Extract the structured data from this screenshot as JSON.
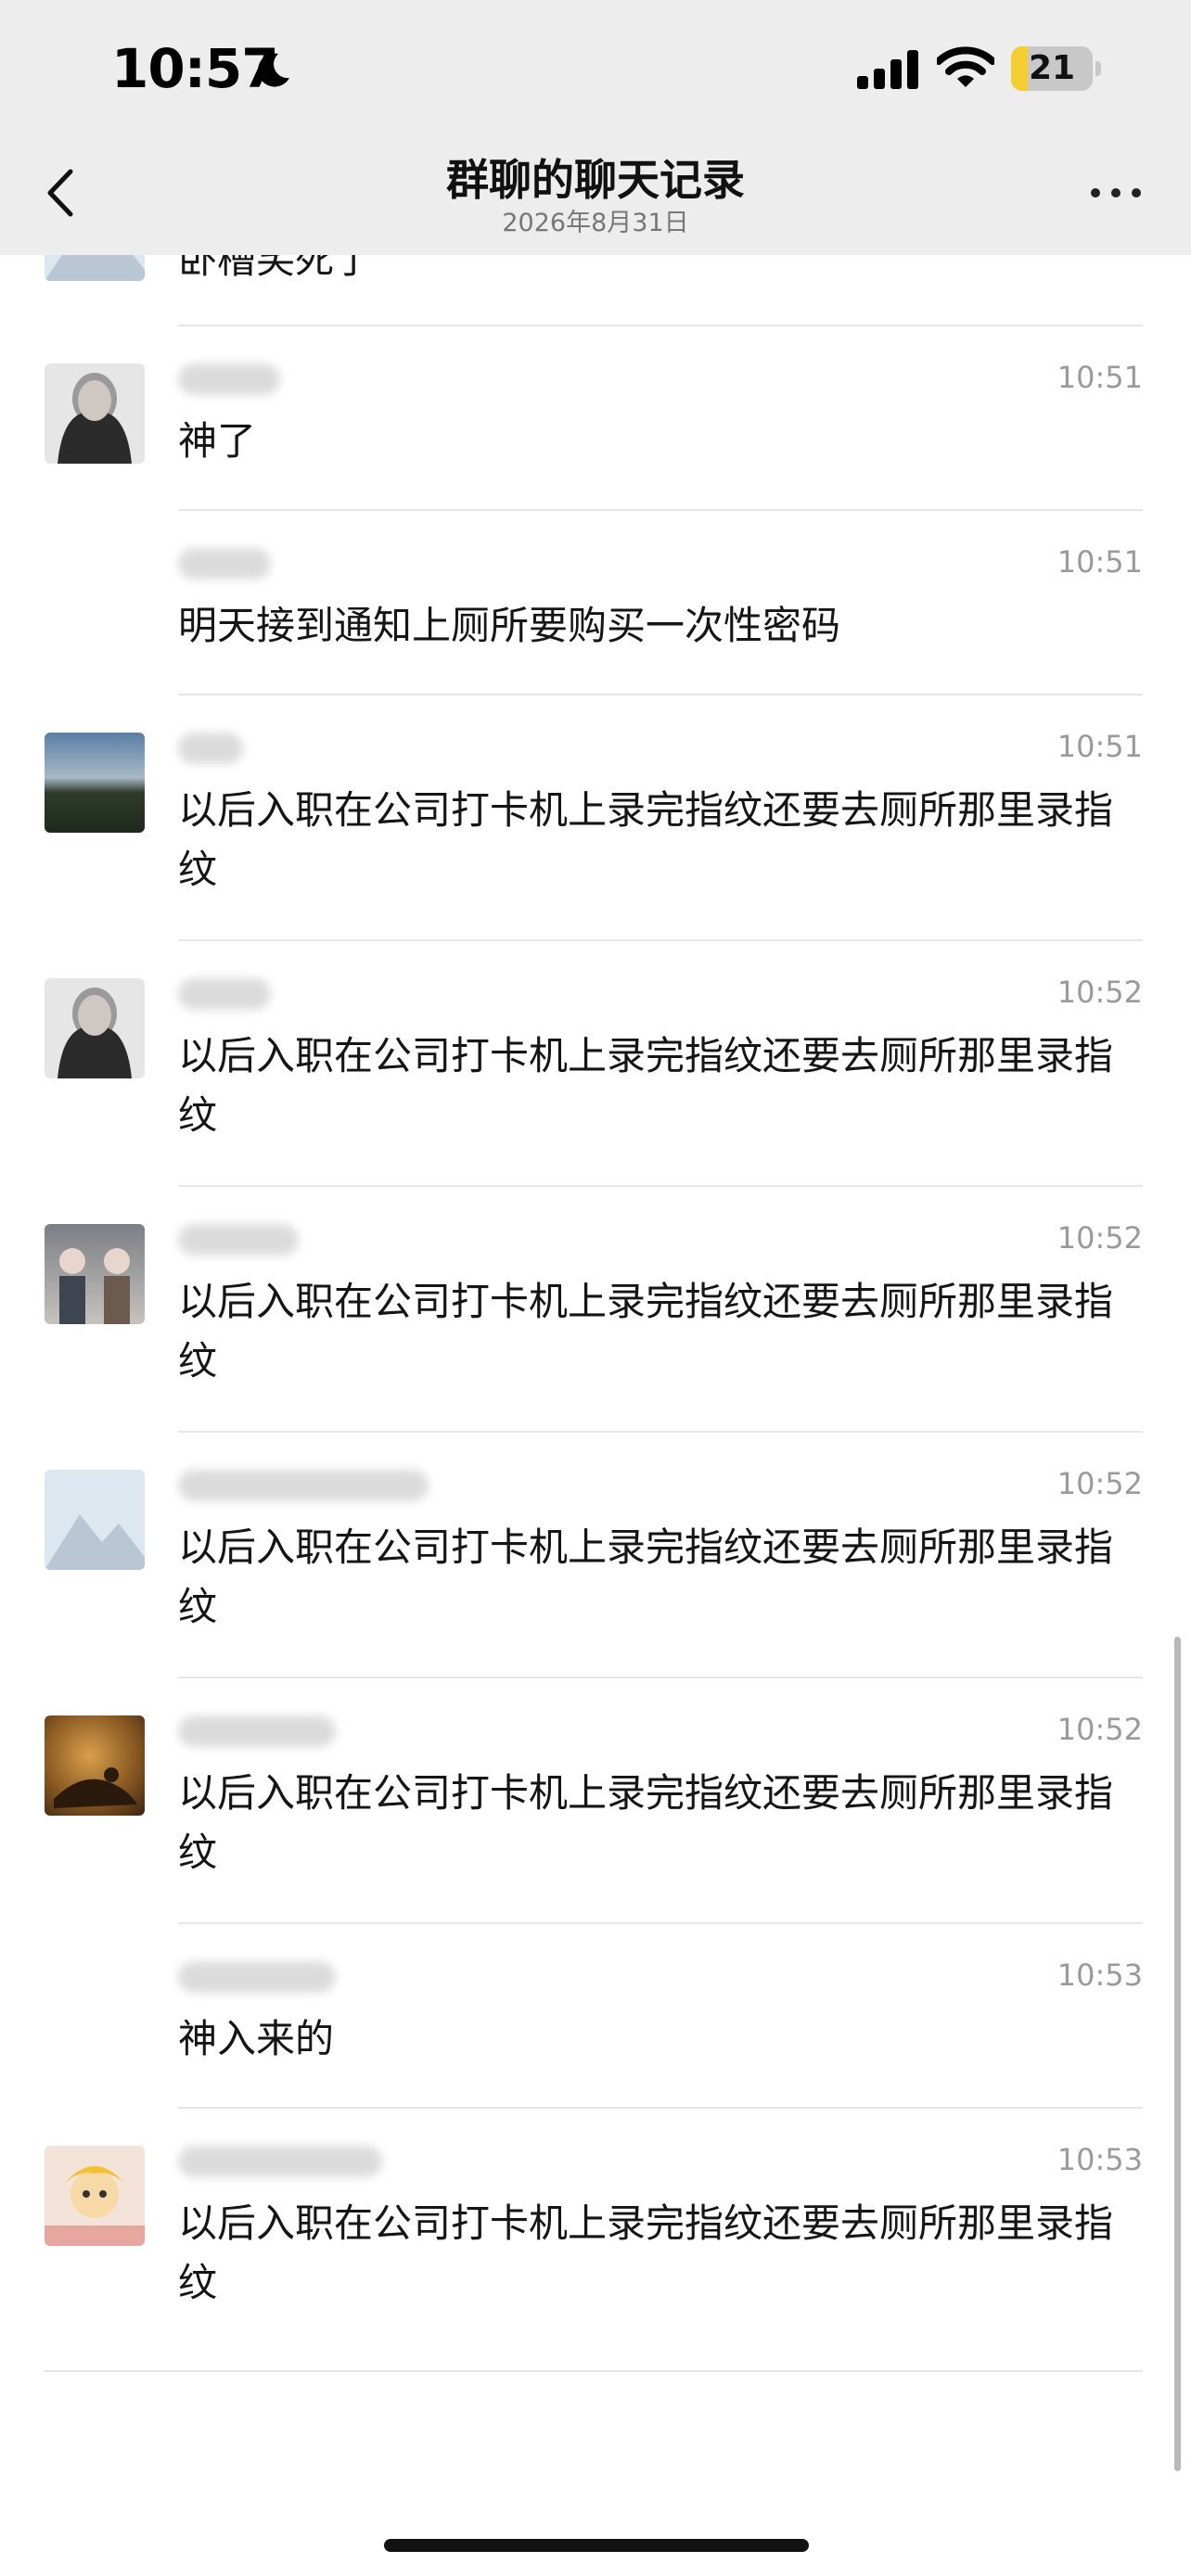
{
  "status_bar": {
    "time": "10:57",
    "battery_level": "21",
    "battery_fraction": 0.21,
    "icons": [
      "moon-icon",
      "signal-icon",
      "wifi-icon",
      "battery-icon"
    ]
  },
  "header": {
    "title": "群聊的聊天记录",
    "date": "2026年8月31日",
    "back_icon": "chevron-left-icon",
    "more_icon": "more-dots-icon"
  },
  "partial_message": {
    "text": "卧槽笑死了"
  },
  "messages": [
    {
      "time": "10:51",
      "text": "神了",
      "avatar": "girl"
    },
    {
      "time": "10:51",
      "text": "明天接到通知上厕所要购买一次性密码",
      "avatar": "none"
    },
    {
      "time": "10:51",
      "text": "以后入职在公司打卡机上录完指纹还要去厕所那里录指纹",
      "avatar": "sky"
    },
    {
      "time": "10:52",
      "text": "以后入职在公司打卡机上录完指纹还要去厕所那里录指纹",
      "avatar": "girl"
    },
    {
      "time": "10:52",
      "text": "以后入职在公司打卡机上录完指纹还要去厕所那里录指纹",
      "avatar": "group"
    },
    {
      "time": "10:52",
      "text": "以后入职在公司打卡机上录完指纹还要去厕所那里录指纹",
      "avatar": "mountain"
    },
    {
      "time": "10:52",
      "text": "以后入职在公司打卡机上录完指纹还要去厕所那里录指纹",
      "avatar": "animal"
    },
    {
      "time": "10:53",
      "text": "神入来的",
      "avatar": "none"
    },
    {
      "time": "10:53",
      "text": "以后入职在公司打卡机上录完指纹还要去厕所那里录指纹",
      "avatar": "cartoon"
    }
  ],
  "colors": {
    "header_bg": "#ededed",
    "battery_fill": "#f4cd2e",
    "time_text": "#9a9a9a",
    "divider": "#e6e6e6"
  }
}
